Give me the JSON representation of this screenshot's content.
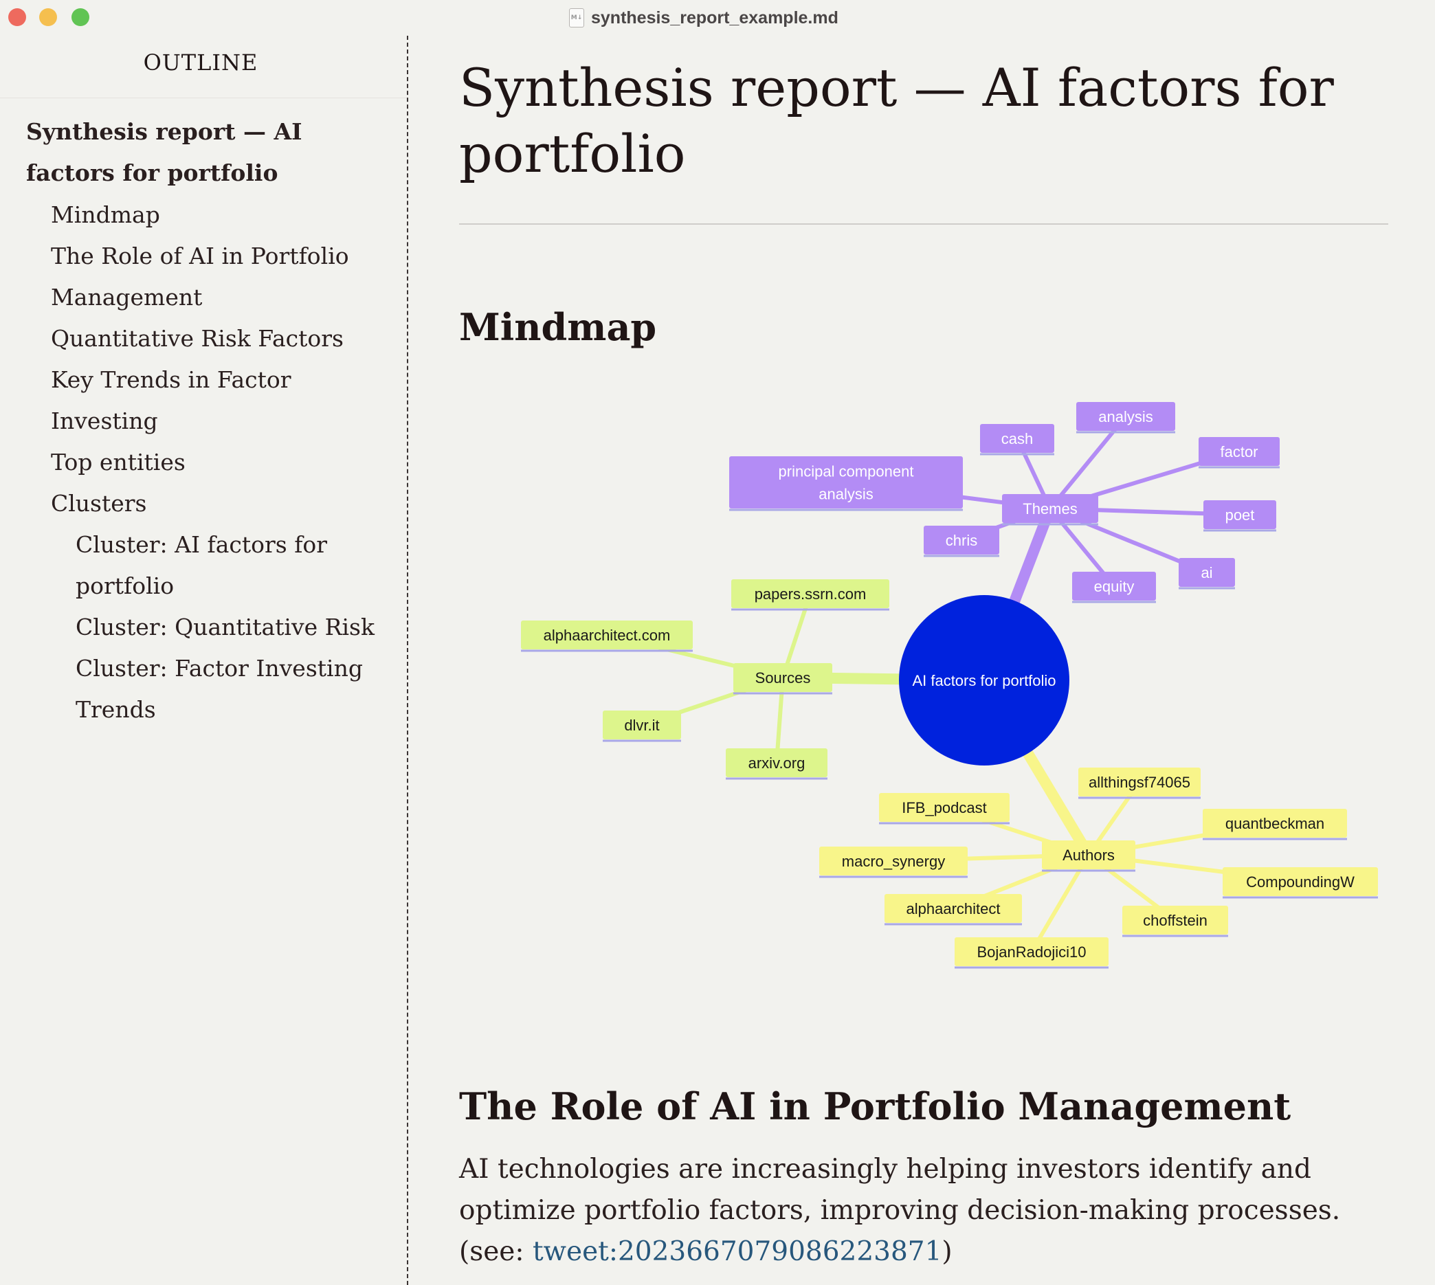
{
  "window": {
    "title": "synthesis_report_example.md",
    "file_icon": "markdown-file-icon"
  },
  "outline": {
    "heading": "OUTLINE",
    "items": [
      {
        "label": "Synthesis report — AI factors for portfolio",
        "level": 1
      },
      {
        "label": "Mindmap",
        "level": 2
      },
      {
        "label": "The Role of AI in Portfolio Management",
        "level": 2
      },
      {
        "label": "Quantitative Risk Factors",
        "level": 2
      },
      {
        "label": "Key Trends in Factor Investing",
        "level": 2
      },
      {
        "label": "Top entities",
        "level": 2
      },
      {
        "label": "Clusters",
        "level": 2
      },
      {
        "label": "Cluster: AI factors for portfolio",
        "level": 3
      },
      {
        "label": "Cluster: Quantitative Risk",
        "level": 3
      },
      {
        "label": "Cluster: Factor Investing Trends",
        "level": 3
      }
    ]
  },
  "document": {
    "title": "Synthesis report — AI factors for portfolio",
    "mindmap_heading": "Mindmap",
    "section1_heading": "The Role of AI in Portfolio Management",
    "section1_text": "AI technologies are increasingly helping investors identify and optimize portfolio factors, improving decision-making processes. (see: ",
    "section1_link": "tweet:2023667079086223871",
    "section1_text_end": ")"
  },
  "mindmap": {
    "root": "AI factors for portfolio",
    "colors": {
      "root": "#0022dd",
      "themes": "#b38cf5",
      "sources": "#ddf58c",
      "authors": "#f8f58a",
      "underline": "#a9a8e6"
    },
    "branches": [
      {
        "label": "Themes",
        "children": [
          "principal component analysis",
          "cash",
          "analysis",
          "factor",
          "poet",
          "ai",
          "equity",
          "chris"
        ]
      },
      {
        "label": "Sources",
        "children": [
          "papers.ssrn.com",
          "alphaarchitect.com",
          "dlvr.it",
          "arxiv.org"
        ]
      },
      {
        "label": "Authors",
        "children": [
          "allthingsf74065",
          "IFB_podcast",
          "quantbeckman",
          "macro_synergy",
          "CompoundingW",
          "alphaarchitect",
          "choffstein",
          "BojanRadojici10"
        ]
      }
    ]
  }
}
